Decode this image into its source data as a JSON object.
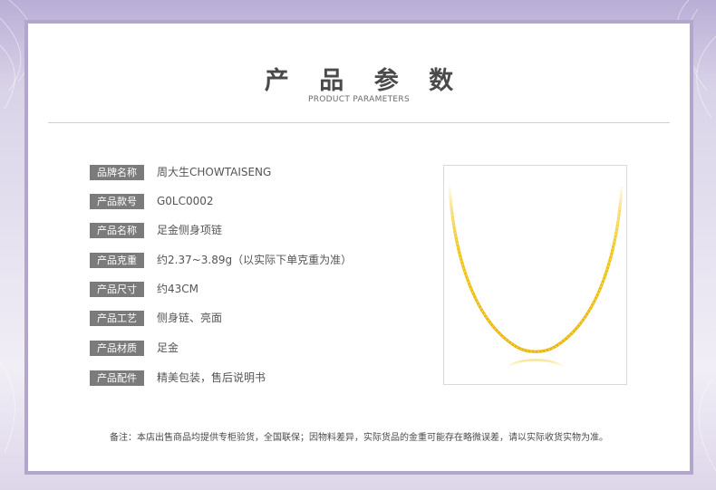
{
  "header": {
    "title": "产 品 参 数",
    "subtitle": "PRODUCT PARAMETERS"
  },
  "params": [
    {
      "label": "品牌名称",
      "value": "周大生CHOWTAISENG"
    },
    {
      "label": "产品款号",
      "value": "G0LC0002"
    },
    {
      "label": "产品名称",
      "value": "足金侧身项链"
    },
    {
      "label": "产品克重",
      "value": "约2.37~3.89g（以实际下单克重为准）"
    },
    {
      "label": "产品尺寸",
      "value": "约43CM"
    },
    {
      "label": "产品工艺",
      "value": "侧身链、亮面"
    },
    {
      "label": "产品材质",
      "value": "足金"
    },
    {
      "label": "产品配件",
      "value": "精美包装，售后说明书"
    }
  ],
  "footer": {
    "note": "备注：本店出售商品均提供专柜验货，全国联保；因物料差异，实际货品的金重可能存在略微误差，请以实际收货实物为准。"
  },
  "colors": {
    "frame_border": "#b2a6cd",
    "label_bg": "#7c7b7b",
    "gold": "#f1c40f",
    "background": "#e9e5f0"
  },
  "icons": {
    "product_image": "gold-chain-necklace"
  }
}
